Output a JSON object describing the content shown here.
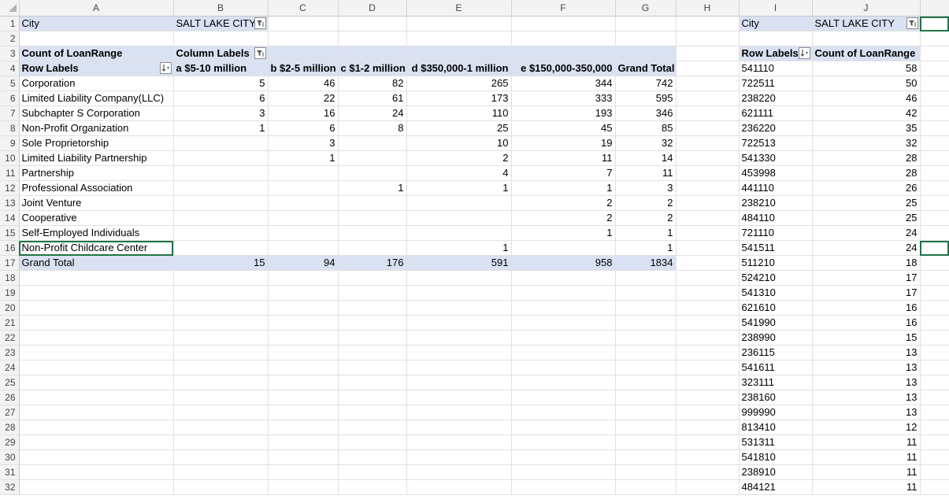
{
  "columns": [
    "A",
    "B",
    "C",
    "D",
    "E",
    "F",
    "G",
    "H",
    "I",
    "J"
  ],
  "filter": {
    "label": "City",
    "value": "SALT LAKE CITY"
  },
  "pivot1": {
    "value_label": "Count of LoanRange",
    "column_labels": "Column Labels",
    "row_labels": "Row Labels",
    "headers": [
      "a $5-10 million",
      "b $2-5 million",
      "c $1-2 million",
      "d $350,000-1 million",
      "e $150,000-350,000",
      "Grand Total"
    ],
    "rows": [
      {
        "label": "Corporation",
        "values": [
          "5",
          "46",
          "82",
          "265",
          "344",
          "742"
        ]
      },
      {
        "label": "Limited  Liability Company(LLC)",
        "values": [
          "6",
          "22",
          "61",
          "173",
          "333",
          "595"
        ]
      },
      {
        "label": "Subchapter S Corporation",
        "values": [
          "3",
          "16",
          "24",
          "110",
          "193",
          "346"
        ]
      },
      {
        "label": "Non-Profit Organization",
        "values": [
          "1",
          "6",
          "8",
          "25",
          "45",
          "85"
        ]
      },
      {
        "label": "Sole Proprietorship",
        "values": [
          "",
          "3",
          "",
          "10",
          "19",
          "32"
        ]
      },
      {
        "label": "Limited Liability Partnership",
        "values": [
          "",
          "1",
          "",
          "2",
          "11",
          "14"
        ]
      },
      {
        "label": "Partnership",
        "values": [
          "",
          "",
          "",
          "4",
          "7",
          "11"
        ]
      },
      {
        "label": "Professional Association",
        "values": [
          "",
          "",
          "1",
          "1",
          "1",
          "3"
        ]
      },
      {
        "label": "Joint Venture",
        "values": [
          "",
          "",
          "",
          "",
          "2",
          "2"
        ]
      },
      {
        "label": "Cooperative",
        "values": [
          "",
          "",
          "",
          "",
          "2",
          "2"
        ]
      },
      {
        "label": "Self-Employed Individuals",
        "values": [
          "",
          "",
          "",
          "",
          "1",
          "1"
        ]
      },
      {
        "label": "Non-Profit Childcare Center",
        "values": [
          "",
          "",
          "",
          "1",
          "",
          "1"
        ]
      }
    ],
    "grand_total": {
      "label": "Grand Total",
      "values": [
        "15",
        "94",
        "176",
        "591",
        "958",
        "1834"
      ]
    }
  },
  "pivot2": {
    "row_labels": "Row Labels",
    "value_label": "Count of LoanRange",
    "rows": [
      {
        "code": "541110",
        "count": "58"
      },
      {
        "code": "722511",
        "count": "50"
      },
      {
        "code": "238220",
        "count": "46"
      },
      {
        "code": "621111",
        "count": "42"
      },
      {
        "code": "236220",
        "count": "35"
      },
      {
        "code": "722513",
        "count": "32"
      },
      {
        "code": "541330",
        "count": "28"
      },
      {
        "code": "453998",
        "count": "28"
      },
      {
        "code": "441110",
        "count": "26"
      },
      {
        "code": "238210",
        "count": "25"
      },
      {
        "code": "484110",
        "count": "25"
      },
      {
        "code": "721110",
        "count": "24"
      },
      {
        "code": "541511",
        "count": "24"
      },
      {
        "code": "511210",
        "count": "18"
      },
      {
        "code": "524210",
        "count": "17"
      },
      {
        "code": "541310",
        "count": "17"
      },
      {
        "code": "621610",
        "count": "16"
      },
      {
        "code": "541990",
        "count": "16"
      },
      {
        "code": "238990",
        "count": "15"
      },
      {
        "code": "236115",
        "count": "13"
      },
      {
        "code": "541611",
        "count": "13"
      },
      {
        "code": "323111",
        "count": "13"
      },
      {
        "code": "238160",
        "count": "13"
      },
      {
        "code": "999990",
        "count": "13"
      },
      {
        "code": "813410",
        "count": "12"
      },
      {
        "code": "531311",
        "count": "11"
      },
      {
        "code": "541810",
        "count": "11"
      },
      {
        "code": "238910",
        "count": "11"
      },
      {
        "code": "484121",
        "count": "11"
      }
    ]
  },
  "row_numbers": [
    "1",
    "2",
    "3",
    "4",
    "5",
    "6",
    "7",
    "8",
    "9",
    "10",
    "11",
    "12",
    "13",
    "14",
    "15",
    "16",
    "17",
    "18",
    "19",
    "20",
    "21",
    "22",
    "23",
    "24",
    "25",
    "26",
    "27",
    "28",
    "29",
    "30",
    "31",
    "32"
  ]
}
